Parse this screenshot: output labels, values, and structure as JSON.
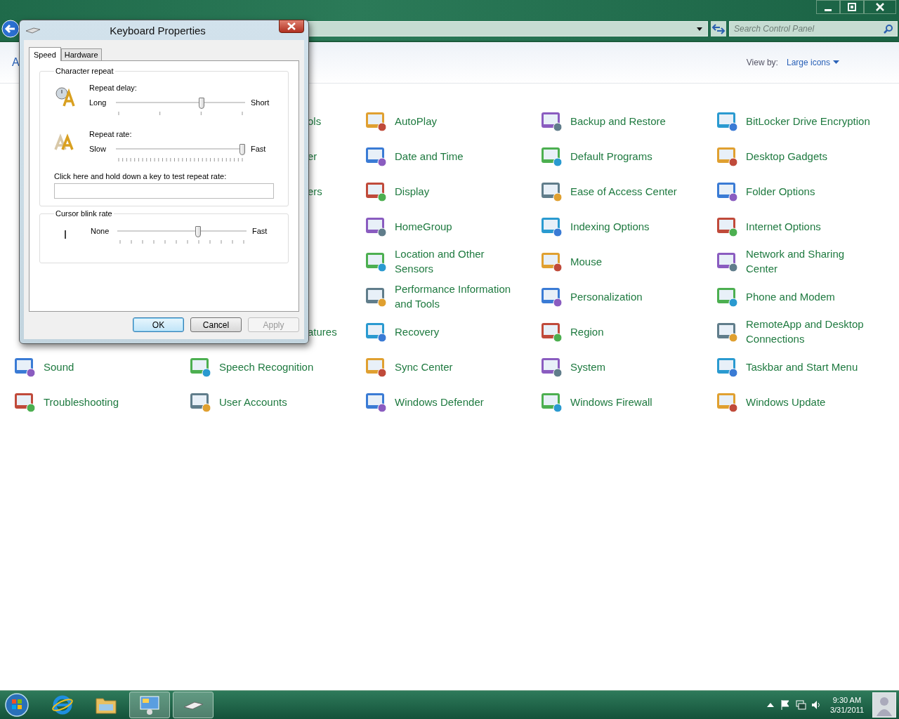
{
  "explorer": {
    "search": {
      "placeholder": "Search Control Panel"
    },
    "header_partial": "A",
    "view_by": {
      "label": "View by:",
      "value": "Large icons"
    }
  },
  "items": [
    {
      "kind": "covered"
    },
    {
      "kind": "partial",
      "label": "ols"
    },
    {
      "kind": "item",
      "label": "AutoPlay"
    },
    {
      "kind": "item",
      "label": "Backup and Restore"
    },
    {
      "kind": "item",
      "label": "BitLocker Drive Encryption"
    },
    {
      "kind": "covered"
    },
    {
      "kind": "partial",
      "label": "er"
    },
    {
      "kind": "item",
      "label": "Date and Time"
    },
    {
      "kind": "item",
      "label": "Default Programs"
    },
    {
      "kind": "item",
      "label": "Desktop Gadgets"
    },
    {
      "kind": "covered"
    },
    {
      "kind": "partial",
      "label": "ers"
    },
    {
      "kind": "item",
      "label": "Display"
    },
    {
      "kind": "item",
      "label": "Ease of Access Center"
    },
    {
      "kind": "item",
      "label": "Folder Options"
    },
    {
      "kind": "covered"
    },
    {
      "kind": "covered"
    },
    {
      "kind": "item",
      "label": "HomeGroup"
    },
    {
      "kind": "item",
      "label": "Indexing Options"
    },
    {
      "kind": "item",
      "label": "Internet Options"
    },
    {
      "kind": "covered"
    },
    {
      "kind": "covered"
    },
    {
      "kind": "item",
      "label": "Location and Other Sensors"
    },
    {
      "kind": "item",
      "label": "Mouse"
    },
    {
      "kind": "item",
      "label": "Network and Sharing Center"
    },
    {
      "kind": "covered"
    },
    {
      "kind": "covered"
    },
    {
      "kind": "item",
      "label": "Performance Information and Tools"
    },
    {
      "kind": "item",
      "label": "Personalization"
    },
    {
      "kind": "item",
      "label": "Phone and Modem"
    },
    {
      "kind": "covered"
    },
    {
      "kind": "partial",
      "label": "atures"
    },
    {
      "kind": "item",
      "label": "Recovery"
    },
    {
      "kind": "item",
      "label": "Region"
    },
    {
      "kind": "item",
      "label": "RemoteApp and Desktop Connections"
    },
    {
      "kind": "item",
      "label": "Sound"
    },
    {
      "kind": "item",
      "label": "Speech Recognition"
    },
    {
      "kind": "item",
      "label": "Sync Center"
    },
    {
      "kind": "item",
      "label": "System"
    },
    {
      "kind": "item",
      "label": "Taskbar and Start Menu"
    },
    {
      "kind": "item",
      "label": "Troubleshooting"
    },
    {
      "kind": "item",
      "label": "User Accounts"
    },
    {
      "kind": "item",
      "label": "Windows Defender"
    },
    {
      "kind": "item",
      "label": "Windows Firewall"
    },
    {
      "kind": "item",
      "label": "Windows Update"
    }
  ],
  "dialog": {
    "title": "Keyboard Properties",
    "tabs": [
      {
        "label": "Speed",
        "selected": true
      },
      {
        "label": "Hardware",
        "selected": false
      }
    ],
    "character_repeat": {
      "title": "Character repeat",
      "sliders": [
        {
          "label": "Repeat delay:",
          "min_label": "Long",
          "max_label": "Short",
          "level": 0.67
        },
        {
          "label": "Repeat rate:",
          "min_label": "Slow",
          "max_label": "Fast",
          "level": 1.0
        }
      ],
      "test_label": "Click here and hold down a key to test repeat rate:"
    },
    "cursor_blink": {
      "title": "Cursor blink rate",
      "min_label": "None",
      "max_label": "Fast",
      "level": 0.63
    },
    "buttons": [
      {
        "label": "OK",
        "default": true,
        "disabled": false
      },
      {
        "label": "Cancel",
        "default": false,
        "disabled": false
      },
      {
        "label": "Apply",
        "default": false,
        "disabled": true
      }
    ]
  },
  "taskbar": {
    "apps": [
      {
        "running": false
      },
      {
        "running": false
      },
      {
        "running": true
      },
      {
        "running": true
      }
    ],
    "time": "9:30 AM",
    "date": "3/31/2011"
  }
}
